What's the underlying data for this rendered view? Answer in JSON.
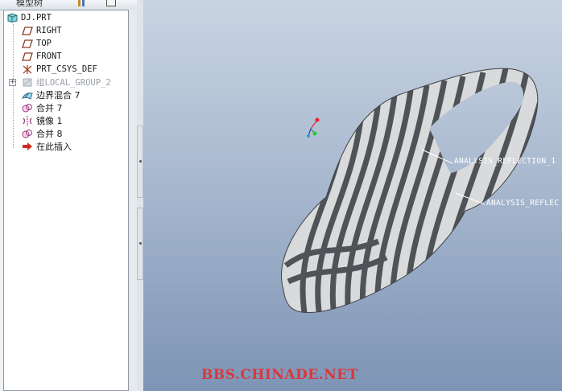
{
  "model_tree": {
    "toolbar_title": "模型树",
    "items": [
      {
        "label": "DJ.PRT",
        "icon": "part-icon"
      },
      {
        "label": "RIGHT",
        "icon": "datum-plane-icon"
      },
      {
        "label": "TOP",
        "icon": "datum-plane-icon"
      },
      {
        "label": "FRONT",
        "icon": "datum-plane-icon"
      },
      {
        "label": "PRT_CSYS_DEF",
        "icon": "csys-icon"
      },
      {
        "label": "组LOCAL_GROUP_2",
        "icon": "group-icon",
        "expander": "+"
      },
      {
        "label": "边界混合 7",
        "icon": "boundary-blend-icon"
      },
      {
        "label": "合并 7",
        "icon": "merge-icon"
      },
      {
        "label": "镜像 1",
        "icon": "mirror-icon"
      },
      {
        "label": "合并 8",
        "icon": "merge-icon"
      },
      {
        "label": "在此插入",
        "icon": "insert-here-arrow-icon"
      }
    ]
  },
  "viewport": {
    "annotations": [
      {
        "text": "ANALYSIS_REFLECTION_1"
      },
      {
        "text": "ANALYSIS_REFLEC"
      }
    ],
    "watermark": "BBS.CHINADE.NET"
  },
  "colors": {
    "viewport_top": "#c9d4e2",
    "viewport_bottom": "#7d94b6",
    "watermark": "#d8383c",
    "stripe_dark": "#4f5357",
    "stripe_light": "#e4e6e8"
  }
}
